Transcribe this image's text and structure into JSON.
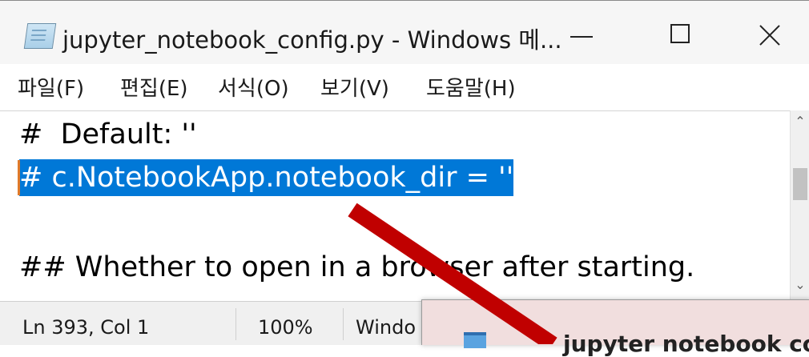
{
  "window": {
    "title": "jupyter_notebook_config.py - Windows 메...",
    "icon": "notepad-icon"
  },
  "menu": [
    {
      "label": "파일(F)"
    },
    {
      "label": "편집(E)"
    },
    {
      "label": "서식(O)"
    },
    {
      "label": "보기(V)"
    },
    {
      "label": "도움말(H)"
    }
  ],
  "editor": {
    "lines": [
      "#  Default: ''",
      "# c.NotebookApp.notebook_dir = ''",
      "",
      "## Whether to open in a browser after starting."
    ],
    "selected_line_index": 1
  },
  "status": {
    "position": "Ln 393, Col 1",
    "zoom": "100%",
    "line_ending": "Windo"
  },
  "popup": {
    "title": "jupyter notebook co",
    "icon": "notepad-icon"
  },
  "colors": {
    "selection": "#0078d7",
    "annotation_arrow": "#c00000"
  }
}
